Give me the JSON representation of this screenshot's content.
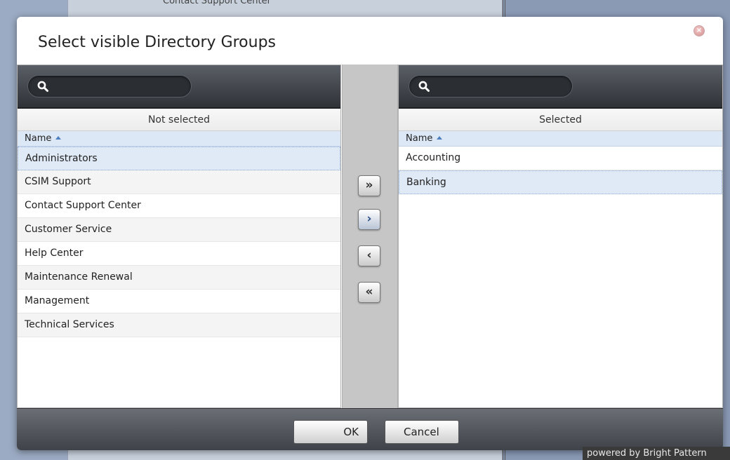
{
  "background": {
    "top_text": "Contact Support Center",
    "powered_by": "powered by Bright Pattern"
  },
  "dialog": {
    "title": "Select visible Directory Groups",
    "close_icon": "close-icon"
  },
  "left_panel": {
    "search_placeholder": "",
    "header": "Not selected",
    "column": "Name",
    "items": [
      "Administrators",
      "CSIM Support",
      "Contact Support Center",
      "Customer Service",
      "Help Center",
      "Maintenance Renewal",
      "Management",
      "Technical Services"
    ],
    "selected_item": "Administrators"
  },
  "right_panel": {
    "search_placeholder": "",
    "header": "Selected",
    "column": "Name",
    "items": [
      "Accounting",
      "Banking"
    ],
    "selected_item": "Banking"
  },
  "move_buttons": {
    "add_all": "»",
    "add": "›",
    "remove": "‹",
    "remove_all": "«"
  },
  "footer": {
    "ok_label": "OK",
    "cancel_label": "Cancel"
  }
}
